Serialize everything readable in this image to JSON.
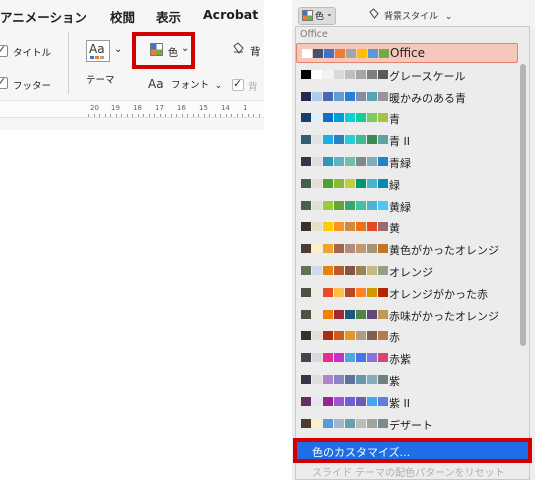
{
  "ribbon": {
    "tabs": [
      "アニメーション",
      "校閲",
      "表示",
      "Acrobat"
    ],
    "title_check_label": "タイトル",
    "footer_check_label": "フッター",
    "theme_label": "テーマ",
    "theme_icon_text": "Aa",
    "colors_label": "色",
    "background_label_partial": "背",
    "font_icon_text": "Aa",
    "font_label": "フォント",
    "background_check_partial": "背",
    "ruler_numbers": [
      "20",
      "19",
      "18",
      "17",
      "16",
      "15",
      "14",
      "1"
    ]
  },
  "dropdown": {
    "color_button_label": "色",
    "bg_style_label": "背景スタイル",
    "section_header": "Office",
    "themes": [
      {
        "name": "Office",
        "selected": true,
        "swatches": [
          "#ffffff",
          "#44546a",
          "#4472c4",
          "#ed7d31",
          "#a5a5a5",
          "#ffc000",
          "#5b9bd5",
          "#70ad47"
        ]
      },
      {
        "name": "グレースケール",
        "swatches": [
          "#000000",
          "#ffffff",
          "#f2f2f2",
          "#d9d9d9",
          "#bfbfbf",
          "#a6a6a6",
          "#7f7f7f",
          "#595959"
        ]
      },
      {
        "name": "暖かみのある青",
        "swatches": [
          "#242852",
          "#acccea",
          "#4a66ac",
          "#629dd1",
          "#297fd5",
          "#7f8fa9",
          "#5aa2ae",
          "#9d90a0"
        ]
      },
      {
        "name": "青",
        "swatches": [
          "#17406d",
          "#dbefff",
          "#0f6fc6",
          "#009dd9",
          "#0bd0d9",
          "#10cf9b",
          "#7cca62",
          "#a5c249"
        ]
      },
      {
        "name": "青 II",
        "swatches": [
          "#335b74",
          "#dfe3e5",
          "#1cade4",
          "#2683c6",
          "#27ced7",
          "#42ba97",
          "#3e8853",
          "#62a39f"
        ]
      },
      {
        "name": "青緑",
        "swatches": [
          "#373545",
          "#dedede",
          "#3494ba",
          "#58b6c0",
          "#75bda7",
          "#7a8c8e",
          "#84acb6",
          "#2683c6"
        ]
      },
      {
        "name": "緑",
        "swatches": [
          "#455f51",
          "#e3ded1",
          "#549e39",
          "#8ab833",
          "#c0cf3a",
          "#029676",
          "#4ab5c4",
          "#0989b1"
        ]
      },
      {
        "name": "黄緑",
        "swatches": [
          "#455f51",
          "#e3ded1",
          "#99cb38",
          "#63a537",
          "#37a76f",
          "#44c1a3",
          "#4eb3cf",
          "#51c3f9"
        ]
      },
      {
        "name": "黄",
        "swatches": [
          "#39302a",
          "#e5dec9",
          "#ffca08",
          "#f8931d",
          "#ce8d3e",
          "#ec7016",
          "#e64823",
          "#9c6a6a"
        ]
      },
      {
        "name": "黄色がかったオレンジ",
        "swatches": [
          "#4e3b30",
          "#fbeec9",
          "#f0a22e",
          "#a5644e",
          "#b58b80",
          "#c3986d",
          "#a19574",
          "#c17529"
        ]
      },
      {
        "name": "オレンジ",
        "swatches": [
          "#637052",
          "#ccddea",
          "#e48312",
          "#bd582c",
          "#865640",
          "#9b8357",
          "#c2bc80",
          "#94a088"
        ]
      },
      {
        "name": "オレンジがかった赤",
        "swatches": [
          "#505046",
          "#eeece1",
          "#e84c22",
          "#ffbd47",
          "#b64926",
          "#ff8427",
          "#cc9900",
          "#b22600"
        ]
      },
      {
        "name": "赤味がかったオレンジ",
        "swatches": [
          "#505046",
          "#eeece1",
          "#f07f09",
          "#9f2936",
          "#1b587c",
          "#4e8542",
          "#604878",
          "#c19859"
        ]
      },
      {
        "name": "赤",
        "swatches": [
          "#323232",
          "#e3ded1",
          "#a5300f",
          "#d55816",
          "#e19825",
          "#b19c7d",
          "#7f5f52",
          "#b27d49"
        ]
      },
      {
        "name": "赤紫",
        "swatches": [
          "#454551",
          "#d8d9dc",
          "#e32d91",
          "#c830cc",
          "#4ea6dc",
          "#4775e7",
          "#8971e1",
          "#d54773"
        ]
      },
      {
        "name": "紫",
        "swatches": [
          "#373545",
          "#dedede",
          "#ad84c6",
          "#8784c7",
          "#5d739a",
          "#6997af",
          "#84acb6",
          "#6f8183"
        ]
      },
      {
        "name": "紫 II",
        "swatches": [
          "#632e62",
          "#eae5eb",
          "#92278f",
          "#9b57d3",
          "#755dd9",
          "#665eb8",
          "#45a5ed",
          "#5982db"
        ]
      },
      {
        "name": "デザート",
        "swatches": [
          "#4e3b30",
          "#fbeec9",
          "#5b9bd5",
          "#a1b6c8",
          "#64a2b3",
          "#bdbdb7",
          "#9fa49d",
          "#7c8c8e"
        ]
      }
    ],
    "customize_label": "色のカスタマイズ...",
    "reset_label": "スライド テーマの配色パターンをリセット"
  }
}
